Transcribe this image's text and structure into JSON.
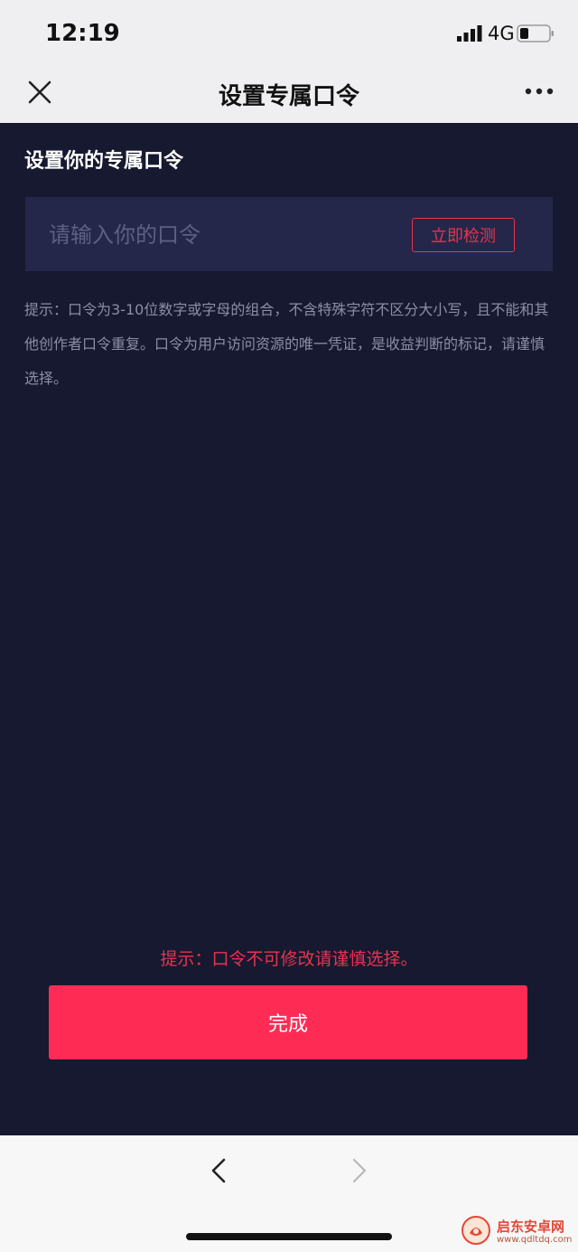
{
  "status_bar": {
    "time": "12:19",
    "network": "4G"
  },
  "nav": {
    "title": "设置专属口令",
    "close_icon": "close-icon",
    "more_icon": "more-icon"
  },
  "form": {
    "section_title": "设置你的专属口令",
    "code_input_value": "",
    "code_input_placeholder": "请输入你的口令",
    "check_button_label": "立即检测",
    "hint": "提示：口令为3-10位数字或字母的组合，不含特殊字符不区分大小写，且不能和其他创作者口令重复。口令为用户访问资源的唯一凭证，是收益判断的标记，请谨慎选择。",
    "warning": "提示：口令不可修改请谨慎选择。",
    "done_button_label": "完成"
  },
  "browser": {
    "back_icon": "chevron-left-icon",
    "forward_icon": "chevron-right-icon"
  },
  "watermark": {
    "title": "启东安卓网",
    "url": "www.qdltdq.com"
  },
  "colors": {
    "background": "#171930",
    "input_bg": "#24274a",
    "accent": "#fe2c55",
    "accent_text": "#e7344f",
    "hint": "#8b8ea6"
  }
}
